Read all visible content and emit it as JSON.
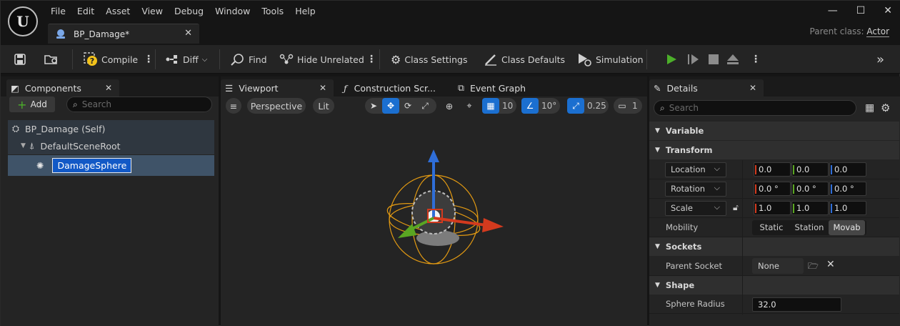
{
  "menu": [
    "File",
    "Edit",
    "Asset",
    "View",
    "Debug",
    "Window",
    "Tools",
    "Help"
  ],
  "doc_tab": {
    "title": "BP_Damage*"
  },
  "parent_class": {
    "label": "Parent class:",
    "value": "Actor"
  },
  "toolbar": {
    "compile": "Compile",
    "diff": "Diff",
    "find": "Find",
    "hide_unrelated": "Hide Unrelated",
    "class_settings": "Class Settings",
    "class_defaults": "Class Defaults",
    "simulation": "Simulation"
  },
  "components": {
    "tab_label": "Components",
    "add_label": "Add",
    "search_placeholder": "Search",
    "items": [
      "BP_Damage (Self)",
      "DefaultSceneRoot",
      "DamageSphere"
    ]
  },
  "editor_tabs": [
    "Viewport",
    "Construction Scr...",
    "Event Graph"
  ],
  "viewport": {
    "perspective": "Perspective",
    "lit": "Lit",
    "grid_snap": "10",
    "rotation_snap": "10°",
    "scale_snap": "0.25",
    "camera_speed": "1"
  },
  "details": {
    "tab_label": "Details",
    "search_placeholder": "Search",
    "categories": {
      "variable": "Variable",
      "transform": "Transform",
      "sockets": "Sockets",
      "shape": "Shape"
    },
    "location": {
      "label": "Location",
      "x": "0.0",
      "y": "0.0",
      "z": "0.0"
    },
    "rotation": {
      "label": "Rotation",
      "x": "0.0 °",
      "y": "0.0 °",
      "z": "0.0 °"
    },
    "scale": {
      "label": "Scale",
      "x": "1.0",
      "y": "1.0",
      "z": "1.0"
    },
    "mobility": {
      "label": "Mobility",
      "options": [
        "Static",
        "Station",
        "Movab"
      ],
      "selected": "Movab"
    },
    "parent_socket": {
      "label": "Parent Socket",
      "value": "None"
    },
    "sphere_radius": {
      "label": "Sphere Radius",
      "value": "32.0"
    }
  },
  "colors": {
    "accent_blue": "#1b6fd0",
    "play_green": "#4caf2a",
    "axis_x": "#d33a1e",
    "axis_y": "#5aa622",
    "axis_z": "#2f6ed8",
    "wire_orange": "#e39a12"
  }
}
